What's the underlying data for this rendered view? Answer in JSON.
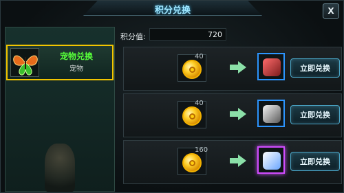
{
  "window": {
    "title": "积分兑换",
    "close_label": "X"
  },
  "sidebar": {
    "tabs": [
      {
        "title": "宠物兑换",
        "subtitle": "宠物",
        "selected": true,
        "icon": "butterfly-pet-icon"
      }
    ]
  },
  "points": {
    "label": "积分值:",
    "value": "720"
  },
  "rewards": [
    {
      "cost": "40",
      "cost_icon": "gold-coin-icon",
      "reward_icon": "dragon-pet-icon",
      "button_label": "立即兑换"
    },
    {
      "cost": "40",
      "cost_icon": "gold-coin-icon",
      "reward_icon": "panda-pet-icon",
      "button_label": "立即兑换"
    },
    {
      "cost": "160",
      "cost_icon": "gold-coin-icon",
      "reward_icon": "white-tiger-pet-icon",
      "button_label": "立即兑换"
    }
  ],
  "colors": {
    "accent": "#9fe6ff",
    "selected_border": "#f2c500",
    "tab_title": "#57ff3a",
    "rare_border": "#2c95ff",
    "epic_border": "#d14cff",
    "arrow": "#8be0a8"
  }
}
